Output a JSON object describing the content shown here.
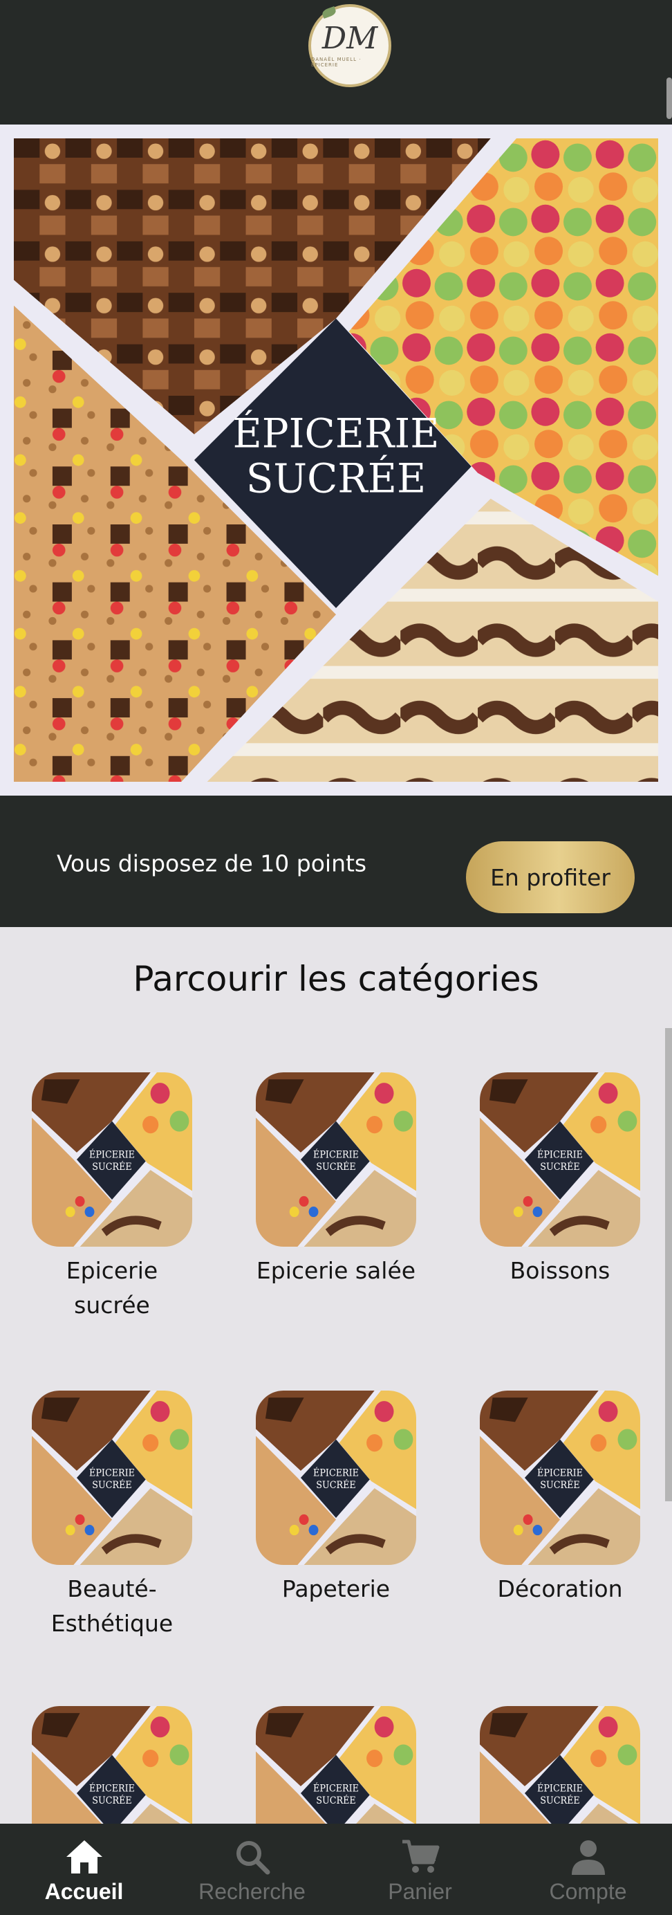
{
  "header": {
    "logo_monogram": "DM",
    "logo_subtitle": "DANAËL MUELL · ÉPICERIE"
  },
  "hero": {
    "title_line1": "ÉPICERIE",
    "title_line2": "SUCRÉE"
  },
  "points": {
    "text": "Vous disposez de 10 points",
    "button_label": "En profiter"
  },
  "categories": {
    "title": "Parcourir les catégories",
    "thumb_line1": "ÉPICERIE",
    "thumb_line2": "SUCRÉE",
    "items": [
      {
        "label": "Epicerie sucrée"
      },
      {
        "label": "Epicerie salée"
      },
      {
        "label": "Boissons"
      },
      {
        "label": "Beauté-Esthétique"
      },
      {
        "label": "Papeterie"
      },
      {
        "label": "Décoration"
      },
      {
        "label": ""
      },
      {
        "label": ""
      },
      {
        "label": ""
      }
    ]
  },
  "nav": {
    "items": [
      {
        "label": "Accueil",
        "icon": "home-icon",
        "active": true
      },
      {
        "label": "Recherche",
        "icon": "search-icon",
        "active": false
      },
      {
        "label": "Panier",
        "icon": "cart-icon",
        "active": false
      },
      {
        "label": "Compte",
        "icon": "user-icon",
        "active": false
      }
    ]
  },
  "colors": {
    "dark_bar": "#262a28",
    "gold_start": "#c6a55a",
    "gold_end": "#e7d08e",
    "page_bg": "#e6e4e8",
    "diamond": "#1f2534"
  }
}
